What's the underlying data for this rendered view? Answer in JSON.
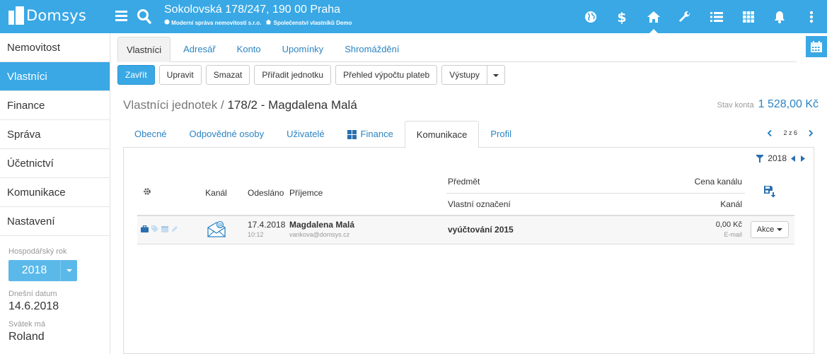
{
  "app": {
    "logo_text": "Domsys",
    "address": "Sokolovská 178/247, 190 00 Praha",
    "company": "Moderní správa nemovitostí s.r.o.",
    "association": "Společenství vlastníků Demo"
  },
  "top_icons": [
    "globe-icon",
    "dollar-icon",
    "home-icon",
    "wrench-icon",
    "list-icon",
    "grid-icon",
    "bell-icon",
    "more-vertical-icon"
  ],
  "sidebar": {
    "items": [
      {
        "label": "Nemovitost"
      },
      {
        "label": "Vlastníci",
        "active": true
      },
      {
        "label": "Finance"
      },
      {
        "label": "Správa"
      },
      {
        "label": "Účetnictví"
      },
      {
        "label": "Komunikace"
      },
      {
        "label": "Nastavení"
      }
    ],
    "fiscal_year_label": "Hospodářský rok",
    "fiscal_year": "2018",
    "today_label": "Dnešní datum",
    "today": "14.6.2018",
    "nameday_label": "Svátek má",
    "nameday": "Roland"
  },
  "top_tabs": [
    "Vlastníci",
    "Adresář",
    "Konto",
    "Upomínky",
    "Shromáždění"
  ],
  "toolbar": {
    "close": "Zavřít",
    "edit": "Upravit",
    "delete": "Smazat",
    "assign_unit": "Přiřadit jednotku",
    "payment_overview": "Přehled výpočtu plateb",
    "outputs": "Výstupy"
  },
  "header": {
    "title_prefix": "Vlastníci jednotek",
    "separator": "/",
    "title": "178/2 - Magdalena Malá",
    "balance_label": "Stav konta",
    "balance_value": "1 528,00 Kč"
  },
  "sub_tabs": [
    "Obecné",
    "Odpovědné osoby",
    "Uživatelé",
    "Finance",
    "Komunikace",
    "Profil"
  ],
  "pager": {
    "text": "2 z 6"
  },
  "filter": {
    "year": "2018"
  },
  "table": {
    "headers": {
      "channel": "Kanál",
      "sent": "Odesláno",
      "recipient": "Příjemce",
      "subject": "Předmět",
      "own_label": "Vlastní označení",
      "channel_price": "Cena kanálu",
      "channel2": "Kanál"
    },
    "rows": [
      {
        "date": "17.4.2018",
        "time": "10:12",
        "recipient_name": "Magdalena Malá",
        "recipient_email": "vankova@domsys.cz",
        "subject": "vyúčtování 2015",
        "price": "0,00 Kč",
        "channel": "E-mail",
        "action": "Akce"
      }
    ]
  }
}
